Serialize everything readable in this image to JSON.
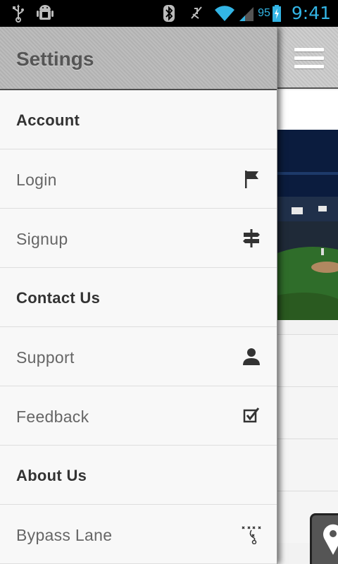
{
  "status_bar": {
    "battery_percent": "95",
    "time": "9:41",
    "icons": [
      "usb-icon",
      "android-debug-icon",
      "bluetooth-icon",
      "vibrate-icon",
      "wifi-icon",
      "signal-icon",
      "battery-charging-icon"
    ],
    "accent_color": "#33b5e5"
  },
  "drawer": {
    "title": "Settings",
    "items": [
      {
        "label": "Account",
        "type": "section"
      },
      {
        "label": "Login",
        "type": "item",
        "icon": "flag-icon"
      },
      {
        "label": "Signup",
        "type": "item",
        "icon": "signpost-icon"
      },
      {
        "label": "Contact Us",
        "type": "section"
      },
      {
        "label": "Support",
        "type": "item",
        "icon": "person-icon"
      },
      {
        "label": "Feedback",
        "type": "item",
        "icon": "checkbox-icon"
      },
      {
        "label": "About Us",
        "type": "section"
      },
      {
        "label": "Bypass Lane",
        "type": "item",
        "icon": "play-diagram-icon"
      }
    ]
  },
  "content": {
    "menu_icon": "hamburger-menu-icon",
    "image": "baseball-stadium-photo",
    "fab_icon": "map-pin-icon"
  }
}
